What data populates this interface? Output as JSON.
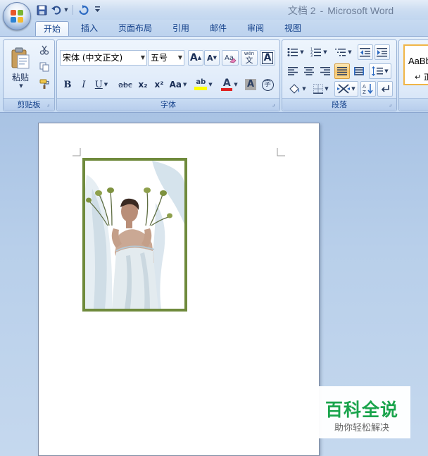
{
  "window": {
    "doc_name": "文档 2",
    "separator": "-",
    "app_name": "Microsoft Word"
  },
  "tabs": [
    {
      "label": "开始",
      "active": true
    },
    {
      "label": "插入"
    },
    {
      "label": "页面布局"
    },
    {
      "label": "引用"
    },
    {
      "label": "邮件"
    },
    {
      "label": "审阅"
    },
    {
      "label": "视图"
    }
  ],
  "clipboard": {
    "label": "剪贴板",
    "paste_label": "粘贴"
  },
  "font": {
    "label": "字体",
    "font_name": "宋体 (中文正文)",
    "font_size": "五号",
    "bold": "B",
    "italic": "I",
    "underline": "U",
    "strikethrough": "abc",
    "subscript": "x₂",
    "superscript": "x²",
    "change_case": "Aa",
    "grow_font": "A",
    "shrink_font": "A",
    "clear_format": "A",
    "pinyin_top": "wén",
    "pinyin_char": "文",
    "char_border": "A",
    "highlight": "ab",
    "font_color": "A",
    "char_shading": "A",
    "enclose_char": "字",
    "highlight_color": "#ffff00",
    "font_color_value": "#e02020"
  },
  "paragraph": {
    "label": "段落"
  },
  "styles": {
    "preview_text": "AaBb",
    "preview_sub": "↵ 正"
  },
  "watermark": {
    "title": "百科全说",
    "subtitle": "助你轻松解决"
  }
}
